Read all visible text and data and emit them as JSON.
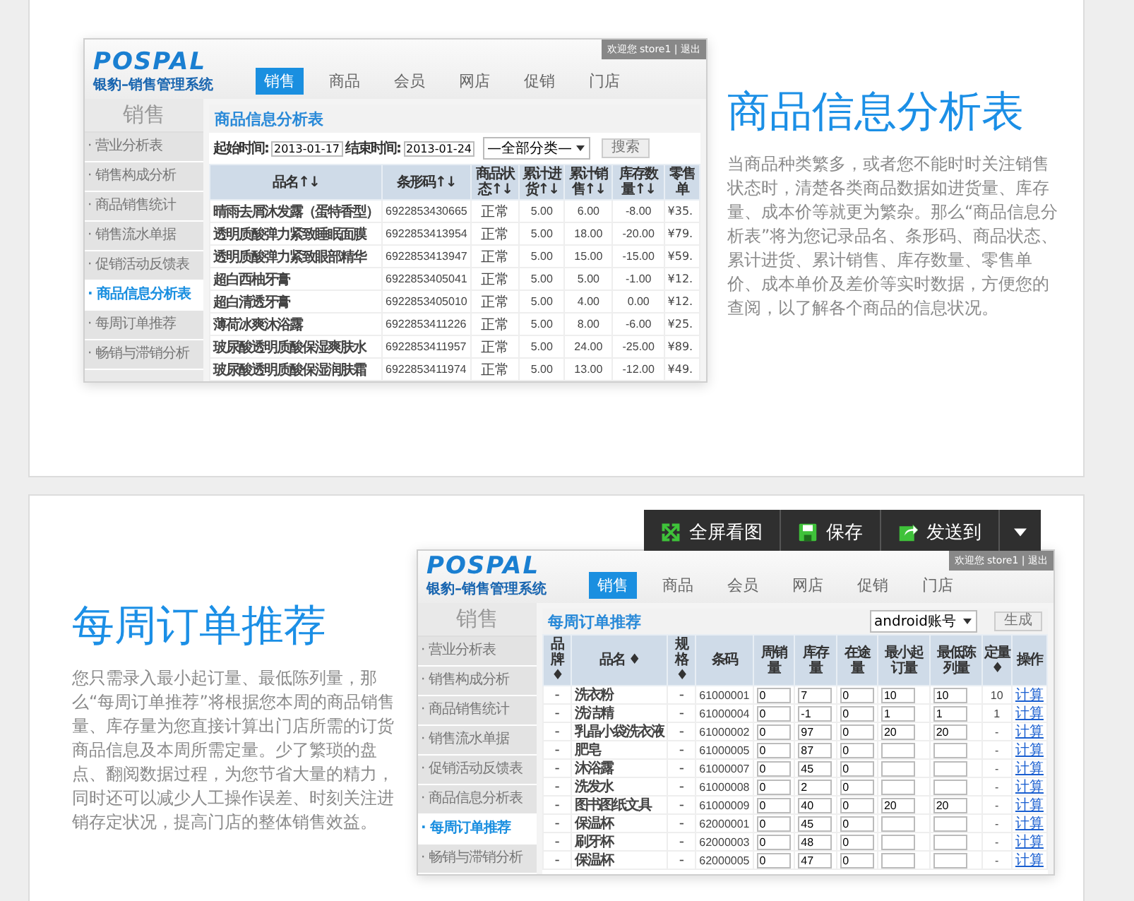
{
  "sections": [
    {
      "kind": "analysis",
      "title": "商品信息分析表",
      "description": "当商品种类繁多，或者您不能时时关注销售状态时，清楚各类商品数据如进货量、库存量、成本价等就更为繁杂。那么“商品信息分析表”将为您记录品名、条形码、商品状态、累计进货、累计销售、库存数量、零售单价、成本单价及差价等实时数据，方便您的查阅，以了解各个商品的信息状况。",
      "app": {
        "logo": "POSPAL",
        "system_name": "银豹–销售管理系统",
        "user_bar": "欢迎您 store1 | 退出",
        "nav": [
          {
            "label": "销售",
            "selected": true
          },
          {
            "label": "商品",
            "selected": false
          },
          {
            "label": "会员",
            "selected": false
          },
          {
            "label": "网店",
            "selected": false
          },
          {
            "label": "促销",
            "selected": false
          },
          {
            "label": "门店",
            "selected": false
          }
        ],
        "sidebar": {
          "title": "销售",
          "items": [
            {
              "label": "· 营业分析表",
              "selected": false
            },
            {
              "label": "· 销售构成分析",
              "selected": false
            },
            {
              "label": "· 商品销售统计",
              "selected": false
            },
            {
              "label": "· 销售流水单据",
              "selected": false
            },
            {
              "label": "· 促销活动反馈表",
              "selected": false
            },
            {
              "label": "· 商品信息分析表",
              "selected": true
            },
            {
              "label": "· 每周订单推荐",
              "selected": false
            },
            {
              "label": "· 畅销与滞销分析",
              "selected": false
            }
          ]
        },
        "panel_title": "商品信息分析表",
        "filter": {
          "start_label": "起始时间:",
          "start": "2013-01-17",
          "end_label": "结束时间:",
          "end": "2013-01-24",
          "category": "—全部分类—",
          "button": "搜索"
        },
        "table": {
          "columns": [
            "品名↑↓",
            "条形码↑↓",
            "商品状态↑↓",
            "累计进货↑↓",
            "累计销售↑↓",
            "库存数量↑↓",
            "零售单"
          ],
          "rows": [
            [
              "晴雨去屑沐发露（蛋特香型）",
              "6922853430665",
              "正常",
              "5.00",
              "6.00",
              "-8.00",
              "¥35."
            ],
            [
              "透明质酸弹力紧致睡眠面膜",
              "6922853413954",
              "正常",
              "5.00",
              "18.00",
              "-20.00",
              "¥79."
            ],
            [
              "透明质酸弹力紧致眼部精华",
              "6922853413947",
              "正常",
              "5.00",
              "15.00",
              "-15.00",
              "¥59."
            ],
            [
              "超白西柚牙膏",
              "6922853405041",
              "正常",
              "5.00",
              "5.00",
              "-1.00",
              "¥12."
            ],
            [
              "超白清透牙膏",
              "6922853405010",
              "正常",
              "5.00",
              "4.00",
              "0.00",
              "¥12."
            ],
            [
              "薄荷冰爽沐浴露",
              "6922853411226",
              "正常",
              "5.00",
              "8.00",
              "-6.00",
              "¥25."
            ],
            [
              "玻尿酸透明质酸保湿爽肤水",
              "6922853411957",
              "正常",
              "5.00",
              "24.00",
              "-25.00",
              "¥89."
            ],
            [
              "玻尿酸透明质酸保湿润肤霜",
              "6922853411974",
              "正常",
              "5.00",
              "13.00",
              "-12.00",
              "¥49."
            ]
          ]
        }
      }
    },
    {
      "kind": "order",
      "title": "每周订单推荐",
      "description": "您只需录入最小起订量、最低陈列量，那么“每周订单推荐”将根据您本周的商品销售量、库存量为您直接计算出门店所需的订货商品信息及本周所需定量。少了繁琐的盘点、翻阅数据过程，为您节省大量的精力，同时还可以减少人工操作误差、时刻关注进销存定状况，提高门店的整体销售效益。",
      "toolbar": [
        {
          "kind": "fullscreen",
          "label": "全屏看图"
        },
        {
          "kind": "save",
          "label": "保存"
        },
        {
          "kind": "send",
          "label": "发送到"
        }
      ],
      "app": {
        "logo": "POSPAL",
        "system_name": "银豹–销售管理系统",
        "user_bar": "欢迎您 store1 | 退出",
        "nav": [
          {
            "label": "销售",
            "selected": true
          },
          {
            "label": "商品",
            "selected": false
          },
          {
            "label": "会员",
            "selected": false
          },
          {
            "label": "网店",
            "selected": false
          },
          {
            "label": "促销",
            "selected": false
          },
          {
            "label": "门店",
            "selected": false
          }
        ],
        "sidebar": {
          "title": "销售",
          "items": [
            {
              "label": "· 营业分析表",
              "selected": false
            },
            {
              "label": "· 销售构成分析",
              "selected": false
            },
            {
              "label": "· 商品销售统计",
              "selected": false
            },
            {
              "label": "· 销售流水单据",
              "selected": false
            },
            {
              "label": "· 促销活动反馈表",
              "selected": false
            },
            {
              "label": "· 商品信息分析表",
              "selected": false
            },
            {
              "label": "· 每周订单推荐",
              "selected": true
            },
            {
              "label": "· 畅销与滞销分析",
              "selected": false
            }
          ]
        },
        "panel_title": "每周订单推荐",
        "controls": {
          "account": "android账号",
          "button": "生成"
        },
        "order_table": {
          "columns": [
            "品牌 ♦",
            "品名 ♦",
            "规格 ♦",
            "条码",
            "周销量",
            "库存量",
            "在途量",
            "最小起订量",
            "最低陈列量",
            "定量 ♦",
            "操作"
          ],
          "rows": [
            {
              "brand": "-",
              "name": "洗衣粉",
              "spec": "-",
              "code": "61000001",
              "weekly": "0",
              "stock": "7",
              "transit": "0",
              "min_order": "10",
              "min_display": "10",
              "quota": "10",
              "action": "计算"
            },
            {
              "brand": "-",
              "name": "洗洁精",
              "spec": "-",
              "code": "61000004",
              "weekly": "0",
              "stock": "-1",
              "transit": "0",
              "min_order": "1",
              "min_display": "1",
              "quota": "1",
              "action": "计算"
            },
            {
              "brand": "-",
              "name": "乳晶小袋洗衣液",
              "spec": "-",
              "code": "61000002",
              "weekly": "0",
              "stock": "97",
              "transit": "0",
              "min_order": "20",
              "min_display": "20",
              "quota": "-",
              "action": "计算"
            },
            {
              "brand": "-",
              "name": "肥皂",
              "spec": "-",
              "code": "61000005",
              "weekly": "0",
              "stock": "87",
              "transit": "0",
              "quota": "-",
              "action": "计算"
            },
            {
              "brand": "-",
              "name": "沐浴露",
              "spec": "-",
              "code": "61000007",
              "weekly": "0",
              "stock": "45",
              "transit": "0",
              "quota": "-",
              "action": "计算"
            },
            {
              "brand": "-",
              "name": "洗发水",
              "spec": "-",
              "code": "61000008",
              "weekly": "0",
              "stock": "2",
              "transit": "0",
              "quota": "-",
              "action": "计算"
            },
            {
              "brand": "-",
              "name": "图书图纸文具",
              "spec": "-",
              "code": "61000009",
              "weekly": "0",
              "stock": "40",
              "transit": "0",
              "min_order": "20",
              "min_display": "20",
              "quota": "-",
              "action": "计算"
            },
            {
              "brand": "-",
              "name": "保温杯",
              "spec": "-",
              "code": "62000001",
              "weekly": "0",
              "stock": "45",
              "transit": "0",
              "quota": "-",
              "action": "计算"
            },
            {
              "brand": "-",
              "name": "刷牙杯",
              "spec": "-",
              "code": "62000003",
              "weekly": "0",
              "stock": "48",
              "transit": "0",
              "quota": "-",
              "action": "计算"
            },
            {
              "brand": "-",
              "name": "保温杯",
              "spec": "-",
              "code": "62000005",
              "weekly": "0",
              "stock": "47",
              "transit": "0",
              "quota": "-",
              "action": "计算"
            }
          ]
        }
      }
    }
  ]
}
